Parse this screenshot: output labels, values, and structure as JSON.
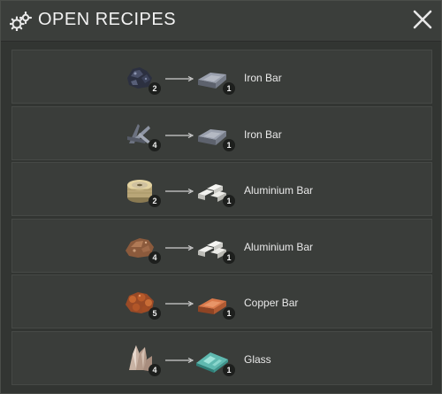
{
  "header": {
    "title": "OPEN RECIPES"
  },
  "colors": {
    "panel": "#323532",
    "row": "#3a3d3a",
    "text": "#e9e9e9",
    "badge": "#1d1f1d"
  },
  "recipes": [
    {
      "ingredient_icon": "iron-ore-icon",
      "ingredient_qty": "2",
      "result_icon": "iron-bar-icon",
      "result_qty": "1",
      "result_label": "Iron Bar"
    },
    {
      "ingredient_icon": "scrap-metal-icon",
      "ingredient_qty": "4",
      "result_icon": "iron-bar-icon",
      "result_qty": "1",
      "result_label": "Iron Bar"
    },
    {
      "ingredient_icon": "wire-spool-icon",
      "ingredient_qty": "2",
      "result_icon": "aluminium-bar-icon",
      "result_qty": "1",
      "result_label": "Aluminium Bar"
    },
    {
      "ingredient_icon": "bauxite-ore-icon",
      "ingredient_qty": "4",
      "result_icon": "aluminium-bar-icon",
      "result_qty": "1",
      "result_label": "Aluminium Bar"
    },
    {
      "ingredient_icon": "copper-ore-icon",
      "ingredient_qty": "5",
      "result_icon": "copper-bar-icon",
      "result_qty": "1",
      "result_label": "Copper Bar"
    },
    {
      "ingredient_icon": "quartz-crystal-icon",
      "ingredient_qty": "4",
      "result_icon": "glass-icon",
      "result_qty": "1",
      "result_label": "Glass"
    }
  ]
}
